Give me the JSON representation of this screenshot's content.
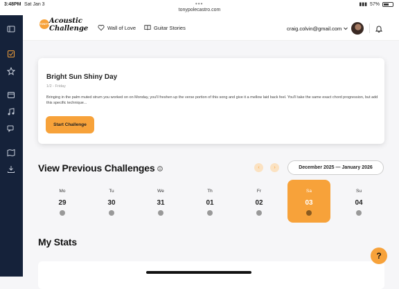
{
  "status": {
    "time": "3:48PM",
    "date": "Sat Jan 3",
    "url": "tonypolecastro.com",
    "battery": "57%",
    "battery_level": 0.57
  },
  "sidebar": {
    "items": [
      {
        "icon": "sidebar-toggle-icon"
      },
      {
        "icon": "checkbox-icon",
        "active": true
      },
      {
        "icon": "star-icon"
      },
      {
        "icon": "calendar-icon"
      },
      {
        "icon": "music-note-icon"
      },
      {
        "icon": "chat-icon"
      },
      {
        "icon": "map-icon"
      },
      {
        "icon": "download-icon"
      }
    ]
  },
  "header": {
    "logo_badge": "TONY'S",
    "logo_text": "Acoustic Challenge",
    "nav": [
      {
        "label": "Wall of Love",
        "icon": "heart-icon"
      },
      {
        "label": "Guitar Stories",
        "icon": "book-icon"
      }
    ],
    "email": "craig.colvin@gmail.com"
  },
  "challenge": {
    "title": "Bright Sun Shiny Day",
    "date": "1/2 - Friday",
    "body": "Bringing in the palm muted strum you worked on on Monday, you'll freshen up the verse portion of this song and give it a mellow laid back feel. You'll take the same exact chord progression, but add this specific technique...",
    "button": "Start Challenge"
  },
  "previous": {
    "title": "View Previous Challenges",
    "range": "December 2025 — January 2026",
    "days": [
      {
        "name": "Mo",
        "num": "29"
      },
      {
        "name": "Tu",
        "num": "30"
      },
      {
        "name": "We",
        "num": "31"
      },
      {
        "name": "Th",
        "num": "01"
      },
      {
        "name": "Fr",
        "num": "02"
      },
      {
        "name": "Sa",
        "num": "03",
        "selected": true
      },
      {
        "name": "Su",
        "num": "04"
      }
    ]
  },
  "stats": {
    "title": "My Stats"
  },
  "help": "?",
  "colors": {
    "accent": "#f7a23a",
    "sidebar": "#15223a"
  }
}
